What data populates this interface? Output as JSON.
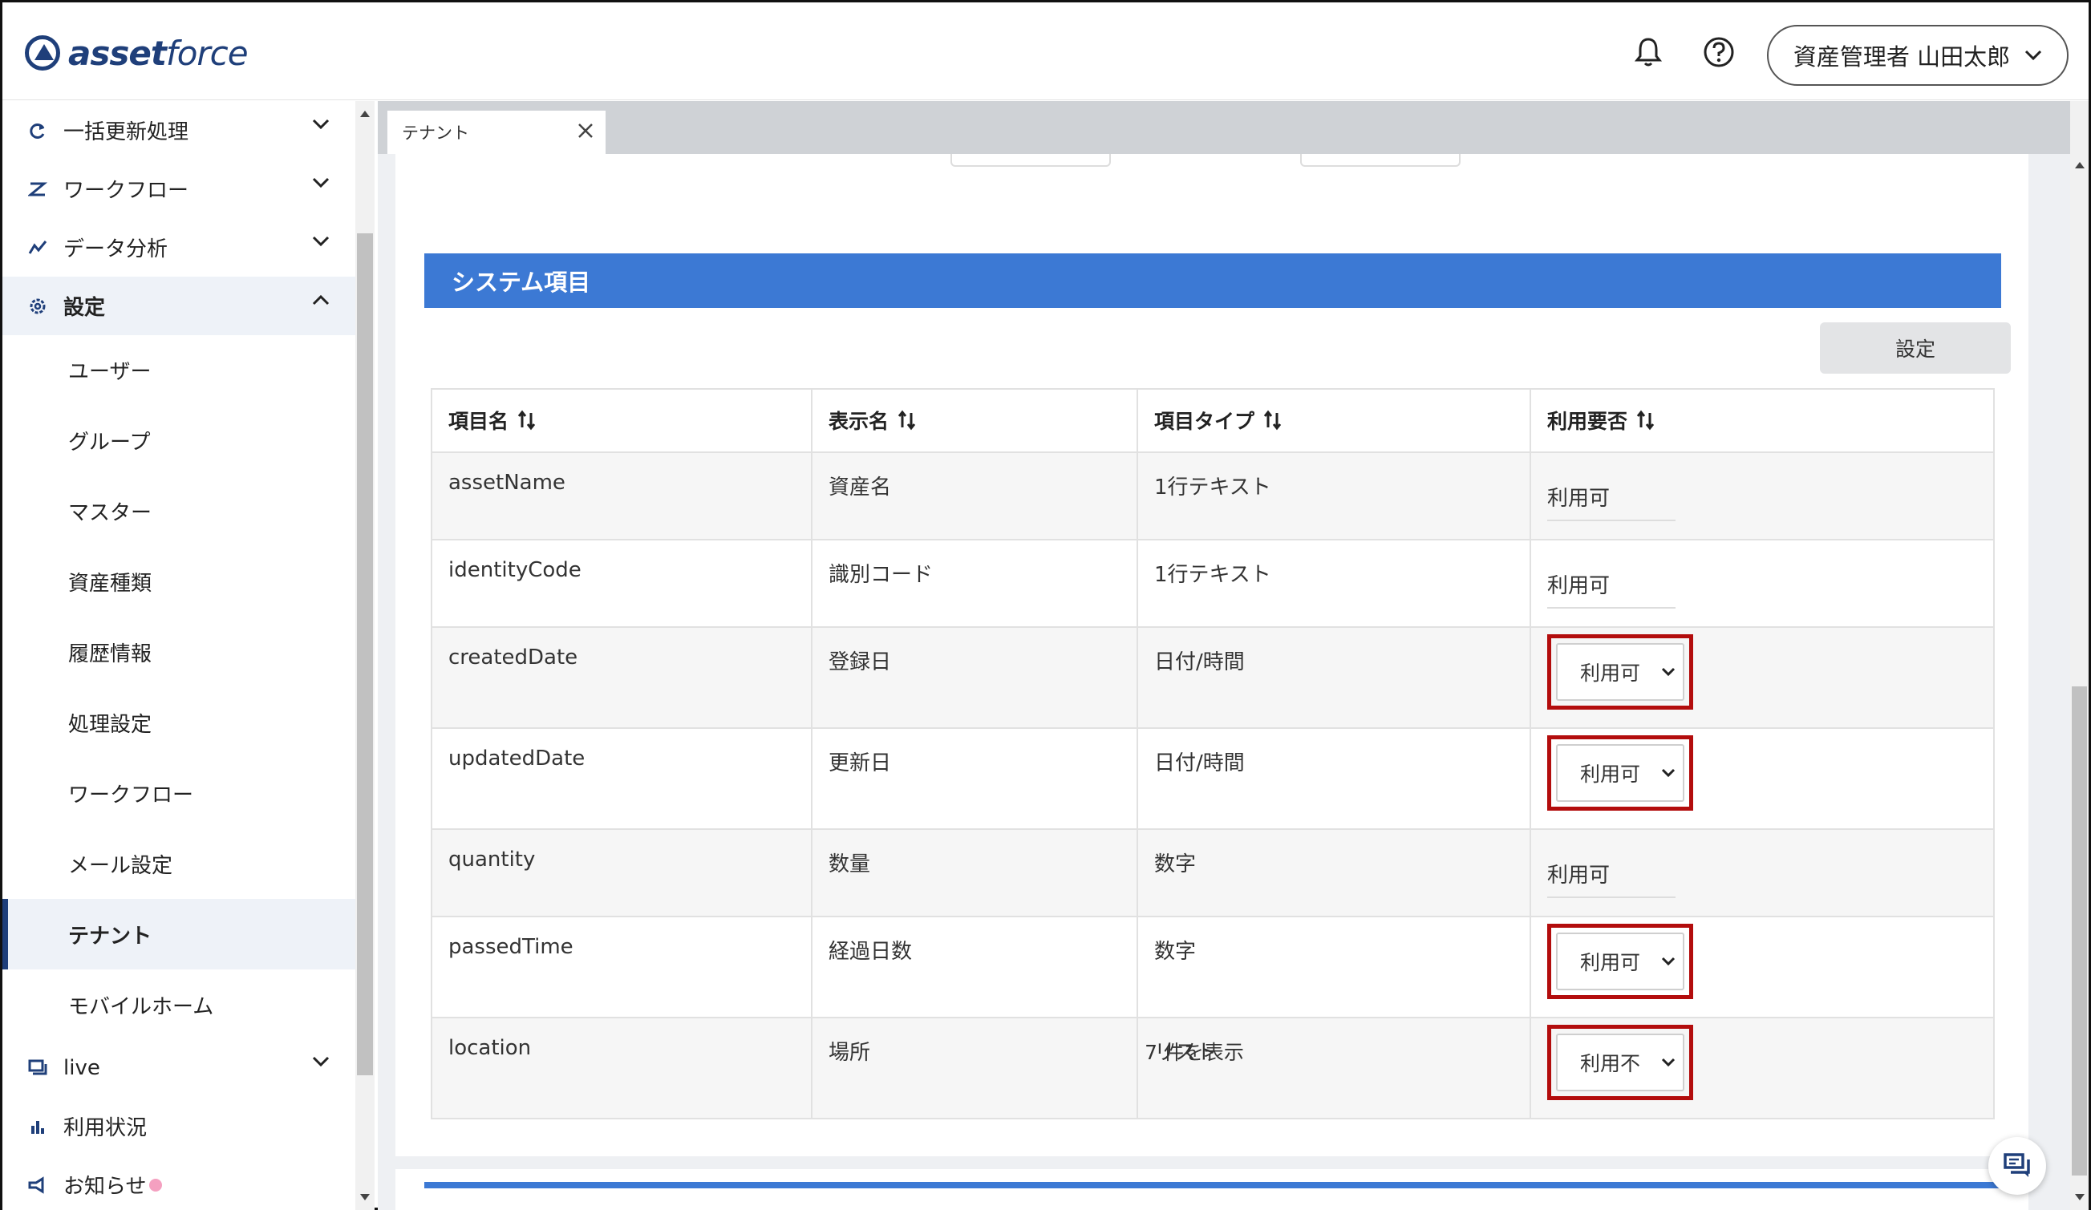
{
  "header": {
    "logo_text_bold": "asset",
    "logo_text_light": "force",
    "user_label": "資産管理者 山田太郎"
  },
  "sidebar": {
    "items": [
      {
        "label": "一括更新処理",
        "icon": "refresh-icon"
      },
      {
        "label": "ワークフロー",
        "icon": "workflow-icon"
      },
      {
        "label": "データ分析",
        "icon": "analytics-icon"
      },
      {
        "label": "設定",
        "icon": "gear-icon"
      }
    ],
    "sub_items": [
      "ユーザー",
      "グループ",
      "マスター",
      "資産種類",
      "履歴情報",
      "処理設定",
      "ワークフロー",
      "メール設定",
      "テナント",
      "モバイルホーム"
    ],
    "bottom_items": [
      {
        "label": "live",
        "icon": "chat-icon"
      },
      {
        "label": "利用状況",
        "icon": "bar-chart-icon"
      },
      {
        "label": "お知らせ",
        "icon": "megaphone-icon"
      }
    ]
  },
  "tabs": [
    {
      "label": "テナント"
    }
  ],
  "section": {
    "title": "システム項目",
    "settings_button": "設定"
  },
  "table": {
    "headers": [
      "項目名",
      "表示名",
      "項目タイプ",
      "利用要否"
    ],
    "rows": [
      {
        "name": "assetName",
        "display": "資産名",
        "type": "1行テキスト",
        "usage": "利用可",
        "editable": false
      },
      {
        "name": "identityCode",
        "display": "識別コード",
        "type": "1行テキスト",
        "usage": "利用可",
        "editable": false
      },
      {
        "name": "createdDate",
        "display": "登録日",
        "type": "日付/時間",
        "usage": "利用可",
        "editable": true
      },
      {
        "name": "updatedDate",
        "display": "更新日",
        "type": "日付/時間",
        "usage": "利用可",
        "editable": true
      },
      {
        "name": "quantity",
        "display": "数量",
        "type": "数字",
        "usage": "利用可",
        "editable": false
      },
      {
        "name": "passedTime",
        "display": "経過日数",
        "type": "数字",
        "usage": "利用可",
        "editable": true
      },
      {
        "name": "location",
        "display": "場所",
        "type": "リスト",
        "usage": "利用不",
        "editable": true
      }
    ],
    "count_text": "7 件を表示"
  },
  "colors": {
    "brand": "#1f3f7a",
    "section_bar": "#3c79d4",
    "highlight_border": "#b30d0d",
    "notice_dot": "#f4a0c0"
  }
}
